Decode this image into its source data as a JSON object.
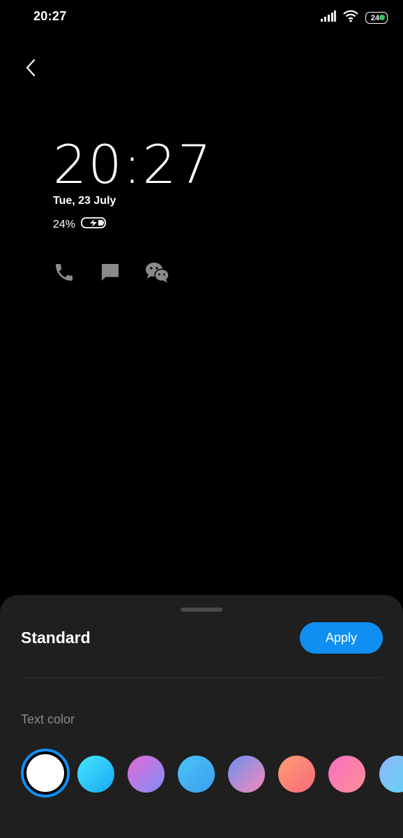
{
  "status_bar": {
    "time": "20:27",
    "battery_level": "24",
    "battery_dot_color": "#35c95b"
  },
  "preview": {
    "clock": "20:27",
    "date": "Tue, 23 July",
    "battery_percent": "24%",
    "notification_icons": [
      "phone-icon",
      "message-icon",
      "wechat-icon"
    ]
  },
  "sheet": {
    "title": "Standard",
    "apply_label": "Apply",
    "section_label": "Text color",
    "accent_color": "#0f8ff2",
    "swatches": [
      {
        "name": "white",
        "gradient": "#ffffff",
        "selected": true
      },
      {
        "name": "cyan",
        "gradient": "linear-gradient(135deg,#46e6ff,#18a8f0)",
        "selected": false
      },
      {
        "name": "pink-purple",
        "gradient": "linear-gradient(135deg,#e36ad5,#7f8ef4)",
        "selected": false
      },
      {
        "name": "sky-blue",
        "gradient": "linear-gradient(135deg,#49c5f4,#3e9df2)",
        "selected": false
      },
      {
        "name": "blue-pink",
        "gradient": "linear-gradient(135deg,#6d8ff2,#f58ab8)",
        "selected": false
      },
      {
        "name": "coral",
        "gradient": "linear-gradient(135deg,#ff9e73,#f76a7b)",
        "selected": false
      },
      {
        "name": "magenta-pink",
        "gradient": "linear-gradient(135deg,#f86fc2,#ff8f96)",
        "selected": false
      },
      {
        "name": "light-blue-partial",
        "gradient": "linear-gradient(135deg,#8eb8f8,#5fd2f4)",
        "selected": false
      }
    ]
  }
}
